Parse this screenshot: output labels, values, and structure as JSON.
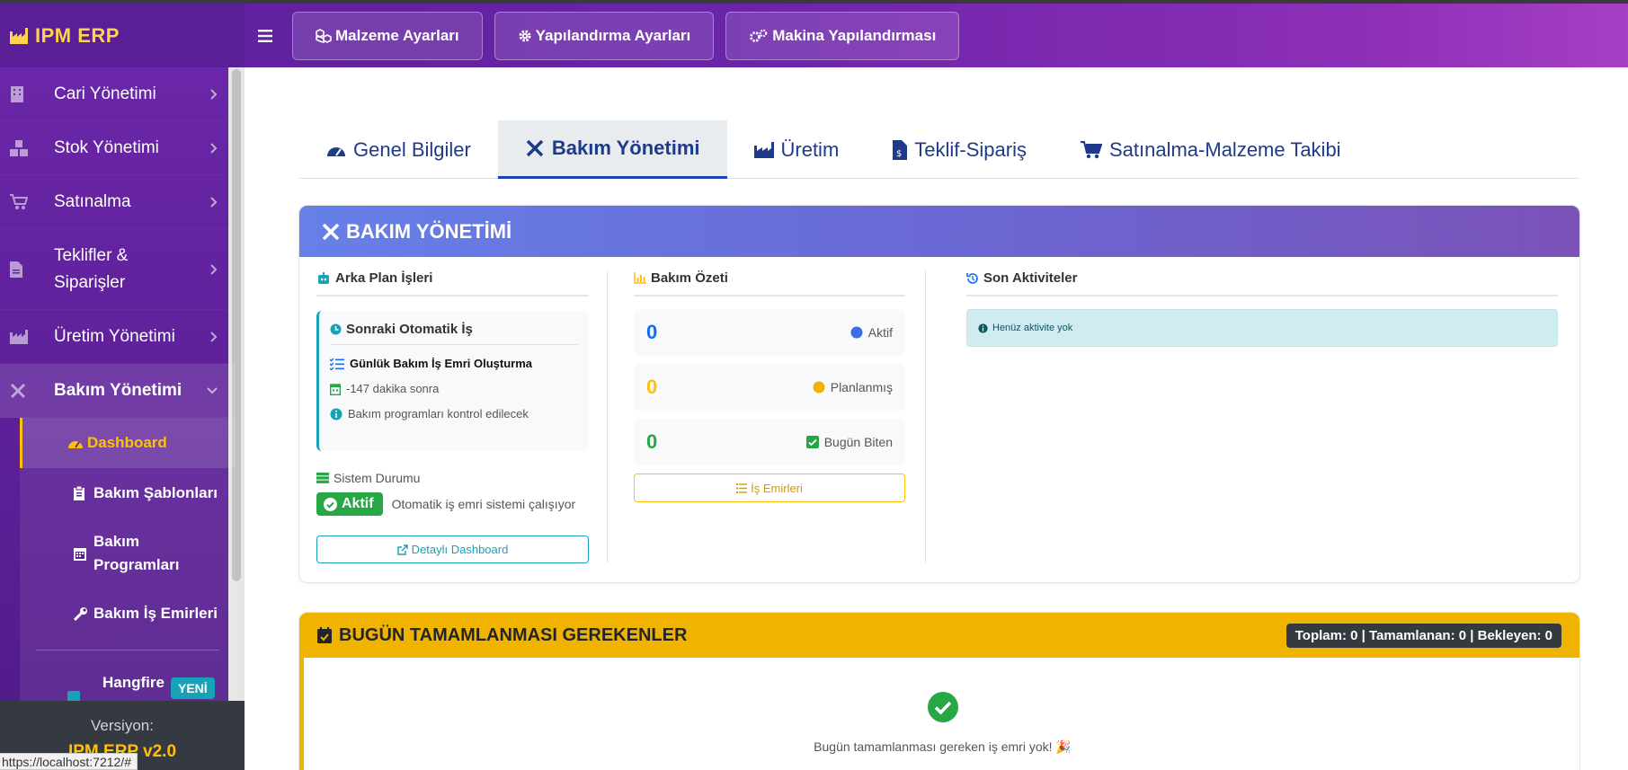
{
  "brand": {
    "name": "IPM ERP"
  },
  "topbar": {
    "buttons": [
      {
        "label": "Malzeme Ayarları"
      },
      {
        "label": "Yapılandırma Ayarları"
      },
      {
        "label": "Makina Yapılandırması"
      }
    ]
  },
  "sidebar": {
    "items": [
      {
        "label": "Cari Yönetimi"
      },
      {
        "label": "Stok Yönetimi"
      },
      {
        "label": "Satınalma"
      },
      {
        "label": "Teklifler & Siparişler"
      },
      {
        "label": "Üretim Yönetimi"
      },
      {
        "label": "Bakım Yönetimi"
      }
    ],
    "subitems": [
      {
        "label": "Dashboard"
      },
      {
        "label": "Bakım Şablonları"
      },
      {
        "label": "Bakım Programları"
      },
      {
        "label": "Bakım İş Emirleri"
      }
    ],
    "hangfire": {
      "label": "Hangfire",
      "badge": "YENİ"
    },
    "version_label": "Versiyon:",
    "version": "IPM ERP v2.0"
  },
  "statusbar": {
    "url": "https://localhost:7212/#"
  },
  "tabs": [
    {
      "label": "Genel Bilgiler"
    },
    {
      "label": "Bakım Yönetimi"
    },
    {
      "label": "Üretim"
    },
    {
      "label": "Teklif-Sipariş"
    },
    {
      "label": "Satınalma-Malzeme Takibi"
    }
  ],
  "maintenance": {
    "title": "BAKIM YÖNETİMİ",
    "background": {
      "title": "Arka Plan İşleri",
      "next_job_title": "Sonraki Otomatik İş",
      "job_name": "Günlük Bakım İş Emri Oluşturma",
      "time": "-147 dakika sonra",
      "info": "Bakım programları kontrol edilecek",
      "system_label": "Sistem Durumu",
      "status_badge": "Aktif",
      "status_text": "Otomatik iş emri sistemi çalışıyor",
      "detail_button": "Detaylı Dashboard"
    },
    "summary": {
      "title": "Bakım Özeti",
      "stats": [
        {
          "value": "0",
          "label": "Aktif",
          "color": "#0d6efd"
        },
        {
          "value": "0",
          "label": "Planlanmış",
          "color": "#ffc107"
        },
        {
          "value": "0",
          "label": "Bugün Biten",
          "color": "#28a745"
        }
      ],
      "orders_button": "İş Emirleri"
    },
    "activities": {
      "title": "Son Aktiviteler",
      "empty": "Henüz aktivite yok"
    }
  },
  "today": {
    "title": "BUGÜN TAMAMLANMASI GEREKENLER",
    "counter": "Toplam: 0 | Tamamlanan: 0 | Bekleyen: 0",
    "empty": "Bugün tamamlanması gereken iş emri yok! 🎉"
  }
}
